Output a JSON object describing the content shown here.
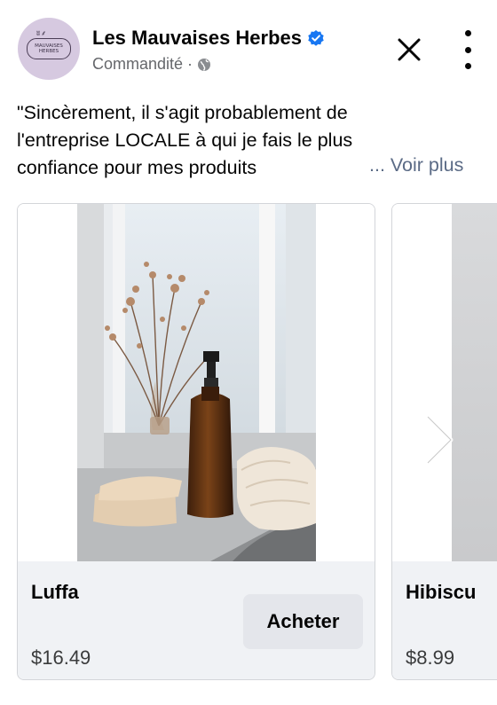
{
  "post": {
    "page_name": "Les Mauvaises Herbes",
    "sponsored_label": "Commandité",
    "separator": "·",
    "avatar_logo_text": [
      "MAUVAISES",
      "HERBES"
    ],
    "text_lines": [
      "\"Sincèrement, il s'agit probablement de",
      "l'entreprise LOCALE à qui je fais le plus",
      "confiance pour mes produits"
    ],
    "see_more_label": "... Voir plus",
    "icons": {
      "verified": "verified-badge-icon",
      "privacy": "globe-icon",
      "close": "close-icon",
      "more": "more-options-icon",
      "next": "chevron-right-icon"
    }
  },
  "carousel": {
    "cards": [
      {
        "name": "Luffa",
        "price": "$16.49",
        "cta": "Acheter"
      },
      {
        "name": "Hibiscu",
        "price": "$8.99"
      }
    ]
  },
  "colors": {
    "verified_blue": "#1877f2",
    "see_more": "#5b6b86",
    "footer_bg": "#f0f2f5",
    "button_bg": "#e4e6eb",
    "avatar_bg": "#d6c9e0"
  }
}
